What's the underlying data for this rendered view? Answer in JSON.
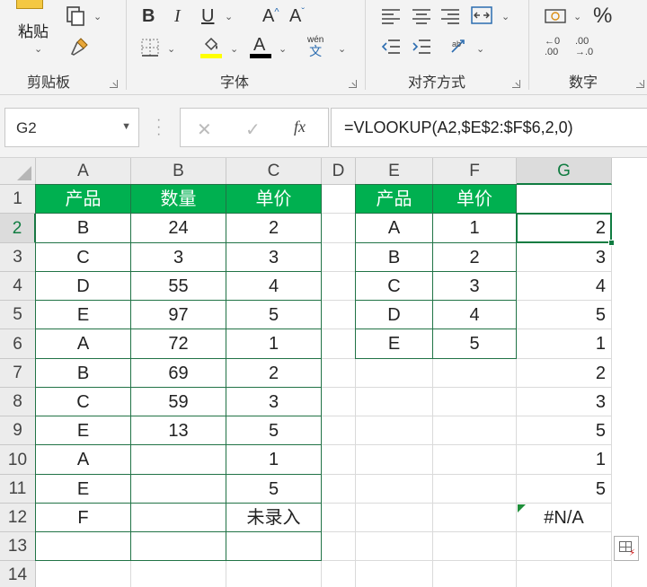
{
  "ribbon": {
    "clipboard": {
      "label": "剪贴板",
      "paste_label": "粘贴",
      "icons": [
        "paste-icon",
        "copy-icon",
        "format-painter-icon"
      ]
    },
    "font": {
      "label": "字体",
      "bold": "B",
      "italic": "I",
      "underline": "U",
      "grow_font": "A",
      "shrink_font": "A",
      "phonetic_top": "wén",
      "phonetic_bottom": "文",
      "font_color_letter": "A",
      "highlight_color": "#ffff00",
      "font_color": "#000000",
      "icons": [
        "borders-icon",
        "fill-color-icon",
        "font-color-icon",
        "phonetic-guide-icon"
      ]
    },
    "alignment": {
      "label": "对齐方式",
      "icons": [
        "align-left-icon",
        "align-center-icon",
        "align-right-icon",
        "merge-center-icon",
        "decrease-indent-icon",
        "increase-indent-icon",
        "wrap-text-icon",
        "orientation-icon"
      ]
    },
    "number": {
      "label": "数字",
      "percent": "%",
      "increase_decimal_top": "←0",
      "increase_decimal_bottom": ".00",
      "decrease_decimal_top": ".00",
      "decrease_decimal_bottom": "→.0",
      "icons": [
        "currency-format-icon",
        "percent-icon",
        "increase-decimal-icon",
        "decrease-decimal-icon"
      ]
    }
  },
  "formula_bar": {
    "name_box": "G2",
    "cancel": "✕",
    "enter": "✓",
    "fx": "fx",
    "formula": "=VLOOKUP(A2,$E$2:$F$6,2,0)"
  },
  "grid": {
    "columns": [
      "A",
      "B",
      "C",
      "D",
      "E",
      "F",
      "G"
    ],
    "active_column": "G",
    "rows": [
      "1",
      "2",
      "3",
      "4",
      "5",
      "6",
      "7",
      "8",
      "9",
      "10",
      "11",
      "12",
      "13",
      "14"
    ],
    "active_row": "2",
    "header_color": "#00b050",
    "table1_headers": [
      "产品",
      "数量",
      "单价"
    ],
    "table1_rows": [
      [
        "B",
        "24",
        "2"
      ],
      [
        "C",
        "3",
        "3"
      ],
      [
        "D",
        "55",
        "4"
      ],
      [
        "E",
        "97",
        "5"
      ],
      [
        "A",
        "72",
        "1"
      ],
      [
        "B",
        "69",
        "2"
      ],
      [
        "C",
        "59",
        "3"
      ],
      [
        "E",
        "13",
        "5"
      ],
      [
        "A",
        "",
        "1"
      ],
      [
        "E",
        "",
        "5"
      ],
      [
        "F",
        "",
        "未录入"
      ],
      [
        "",
        "",
        ""
      ]
    ],
    "table2_headers": [
      "产品",
      "单价"
    ],
    "table2_rows": [
      [
        "A",
        "1"
      ],
      [
        "B",
        "2"
      ],
      [
        "C",
        "3"
      ],
      [
        "D",
        "4"
      ],
      [
        "E",
        "5"
      ]
    ],
    "g_values": [
      "2",
      "3",
      "4",
      "5",
      "1",
      "2",
      "3",
      "5",
      "1",
      "5",
      "#N/A"
    ]
  }
}
